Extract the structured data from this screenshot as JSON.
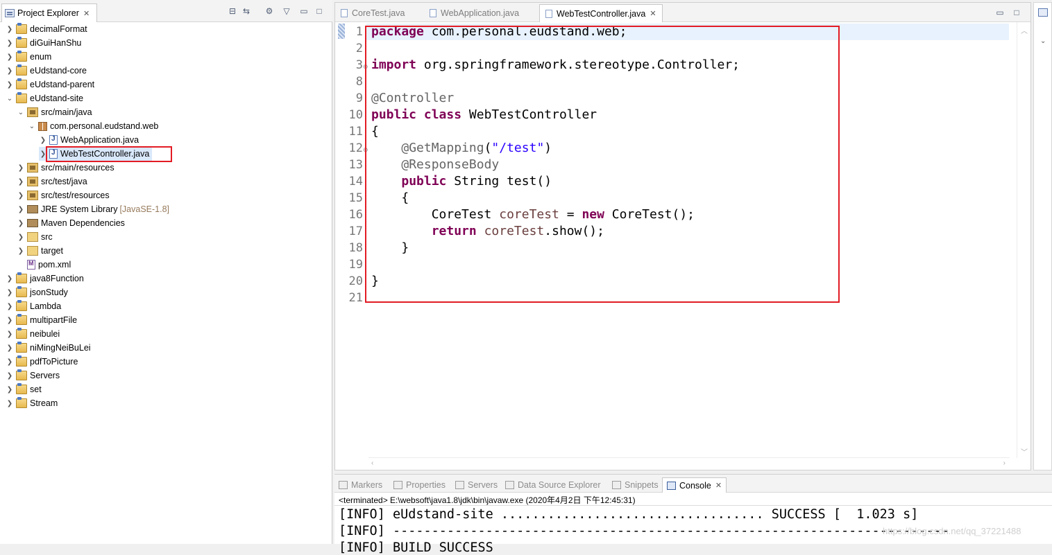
{
  "explorer": {
    "tab_label": "Project Explorer",
    "close": "✕",
    "toolbar": [
      "collapse-all",
      "link-with-editor",
      "filters",
      "view-menu",
      "minimize",
      "maximize"
    ],
    "items": [
      {
        "label": "decimalFormat",
        "icon": "project-icon",
        "expanded": false
      },
      {
        "label": "diGuiHanShu",
        "icon": "project-icon",
        "expanded": false
      },
      {
        "label": "enum",
        "icon": "project-icon",
        "expanded": false
      },
      {
        "label": "eUdstand-core",
        "icon": "project-icon",
        "expanded": false
      },
      {
        "label": "eUdstand-parent",
        "icon": "project-icon",
        "expanded": false
      },
      {
        "label": "eUdstand-site",
        "icon": "project-icon",
        "expanded": true
      },
      {
        "label": "src/main/java",
        "icon": "source-folder-icon",
        "expanded": true
      },
      {
        "label": "com.personal.eudstand.web",
        "icon": "package-icon",
        "expanded": true
      },
      {
        "label": "WebApplication.java",
        "icon": "java-file-icon",
        "expanded": false
      },
      {
        "label": "WebTestController.java",
        "icon": "java-file-icon",
        "expanded": false
      },
      {
        "label": "src/main/resources",
        "icon": "source-folder-icon",
        "expanded": false
      },
      {
        "label": "src/test/java",
        "icon": "source-folder-icon",
        "expanded": false
      },
      {
        "label": "src/test/resources",
        "icon": "source-folder-icon",
        "expanded": false
      },
      {
        "label": "JRE System Library",
        "extra": "[JavaSE-1.8]",
        "icon": "library-icon",
        "expanded": false
      },
      {
        "label": "Maven Dependencies",
        "icon": "library-icon",
        "expanded": false
      },
      {
        "label": "src",
        "icon": "folder-icon",
        "expanded": false
      },
      {
        "label": "target",
        "icon": "folder-icon",
        "expanded": false
      },
      {
        "label": "pom.xml",
        "icon": "xml-file-icon"
      },
      {
        "label": "java8Function",
        "icon": "project-icon",
        "expanded": false
      },
      {
        "label": "jsonStudy",
        "icon": "project-icon",
        "expanded": false
      },
      {
        "label": "Lambda",
        "icon": "project-icon",
        "expanded": false
      },
      {
        "label": "multipartFile",
        "icon": "project-icon",
        "expanded": false
      },
      {
        "label": "neibulei",
        "icon": "project-icon",
        "expanded": false
      },
      {
        "label": "niMingNeiBuLei",
        "icon": "project-icon",
        "expanded": false
      },
      {
        "label": "pdfToPicture",
        "icon": "project-icon",
        "expanded": false
      },
      {
        "label": "Servers",
        "icon": "project-icon",
        "expanded": false
      },
      {
        "label": "set",
        "icon": "project-icon",
        "expanded": false
      },
      {
        "label": "Stream",
        "icon": "project-icon",
        "expanded": false
      }
    ]
  },
  "editor": {
    "tabs": [
      {
        "label": "CoreTest.java",
        "active": false
      },
      {
        "label": "WebApplication.java",
        "active": false
      },
      {
        "label": "WebTestController.java",
        "active": true
      }
    ],
    "line_numbers": [
      "1",
      "2",
      "3",
      "8",
      "9",
      "10",
      "11",
      "12",
      "13",
      "14",
      "15",
      "16",
      "17",
      "18",
      "19",
      "20",
      "21"
    ],
    "lines": [
      "package com.personal.eudstand.web;",
      "",
      "import org.springframework.stereotype.Controller;",
      "",
      "@Controller",
      "public class WebTestController",
      "{",
      "    @GetMapping(\"/test\")",
      "    @ResponseBody",
      "    public String test()",
      "    {",
      "        CoreTest coreTest = new CoreTest();",
      "        return coreTest.show();",
      "    }",
      "",
      "}",
      ""
    ]
  },
  "console": {
    "tabs": [
      {
        "label": "Markers",
        "icon": "markers-icon"
      },
      {
        "label": "Properties",
        "icon": "properties-icon"
      },
      {
        "label": "Servers",
        "icon": "servers-icon"
      },
      {
        "label": "Data Source Explorer",
        "icon": "data-source-icon"
      },
      {
        "label": "Snippets",
        "icon": "snippets-icon"
      },
      {
        "label": "Console",
        "icon": "console-icon",
        "active": true
      }
    ],
    "terminated": "<terminated> E:\\websoft\\java1.8\\jdk\\bin\\javaw.exe (2020年4月2日 下午12:45:31)",
    "output": [
      "[INFO] eUdstand-site .................................. SUCCESS [  1.023 s]",
      "[INFO] ------------------------------------------------------------------------",
      "[INFO] BUILD SUCCESS"
    ],
    "watermark": "https://blog.csdn.net/qq_37221488"
  },
  "colors": {
    "highlight_border": "#e31b23",
    "keyword": "#7f0055",
    "string": "#2a00ff",
    "annotation": "#646464",
    "field": "#6a3e3e"
  }
}
